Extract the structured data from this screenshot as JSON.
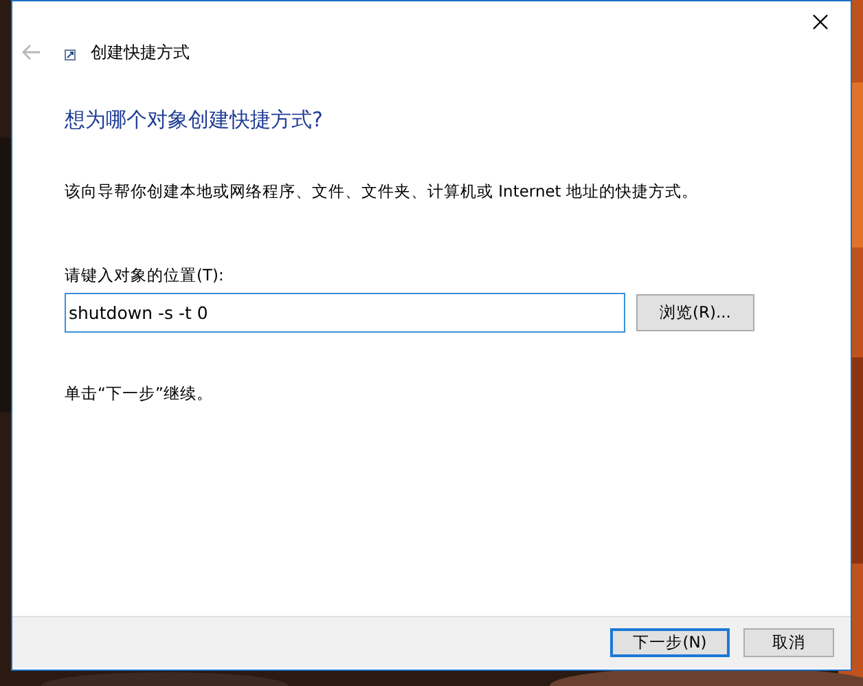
{
  "window": {
    "title": "创建快捷方式",
    "back_disabled": true
  },
  "heading": "想为哪个对象创建快捷方式?",
  "description": "该向导帮你创建本地或网络程序、文件、文件夹、计算机或 Internet 地址的快捷方式。",
  "location": {
    "label": "请键入对象的位置(T):",
    "value": "shutdown -s -t 0",
    "browse_button": "浏览(R)..."
  },
  "hint": "单击“下一步”继续。",
  "buttons": [
    {
      "label": "下一步(N)",
      "default": true
    },
    {
      "label": "取消",
      "default": false
    }
  ]
}
